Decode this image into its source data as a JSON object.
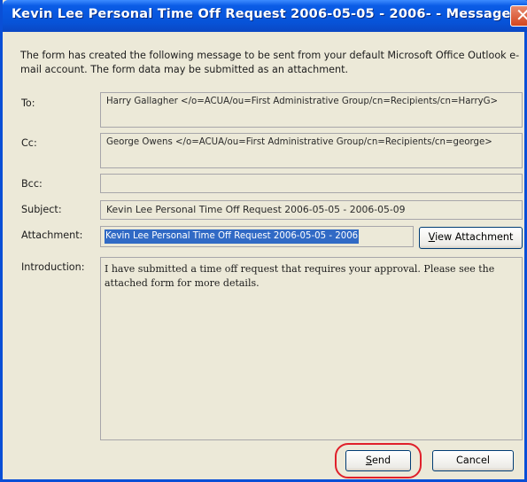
{
  "window": {
    "title": "Kevin Lee Personal Time Off Request 2006-05-05 - 2006- - Message",
    "close_glyph": "✕"
  },
  "description": "The form has created the following message to be sent from your default Microsoft Office Outlook e-mail account. The form data may be submitted as an attachment.",
  "fields": {
    "to_label": "To:",
    "to_value": "Harry Gallagher </o=ACUA/ou=First Administrative Group/cn=Recipients/cn=HarryG>",
    "cc_label": "Cc:",
    "cc_value": "George Owens </o=ACUA/ou=First Administrative Group/cn=Recipients/cn=george>",
    "bcc_label": "Bcc:",
    "bcc_value": "",
    "subject_label": "Subject:",
    "subject_value": "Kevin Lee Personal Time Off Request 2006-05-05 - 2006-05-09",
    "attachment_label": "Attachment:",
    "attachment_value": "Kevin Lee Personal Time Off Request 2006-05-05 - 2006",
    "introduction_label": "Introduction:",
    "introduction_value": "I have submitted a time off request that requires your approval.  Please see the attached form for more details."
  },
  "buttons": {
    "view_attachment_hotkey": "V",
    "view_attachment_rest": "iew Attachment",
    "send_hotkey": "S",
    "send_rest": "end",
    "cancel": "Cancel"
  },
  "colors": {
    "title_bar": "#0753d8",
    "dialog_background": "#ece9d8",
    "selection": "#316ac5",
    "highlight_annotation": "#e0202a"
  }
}
